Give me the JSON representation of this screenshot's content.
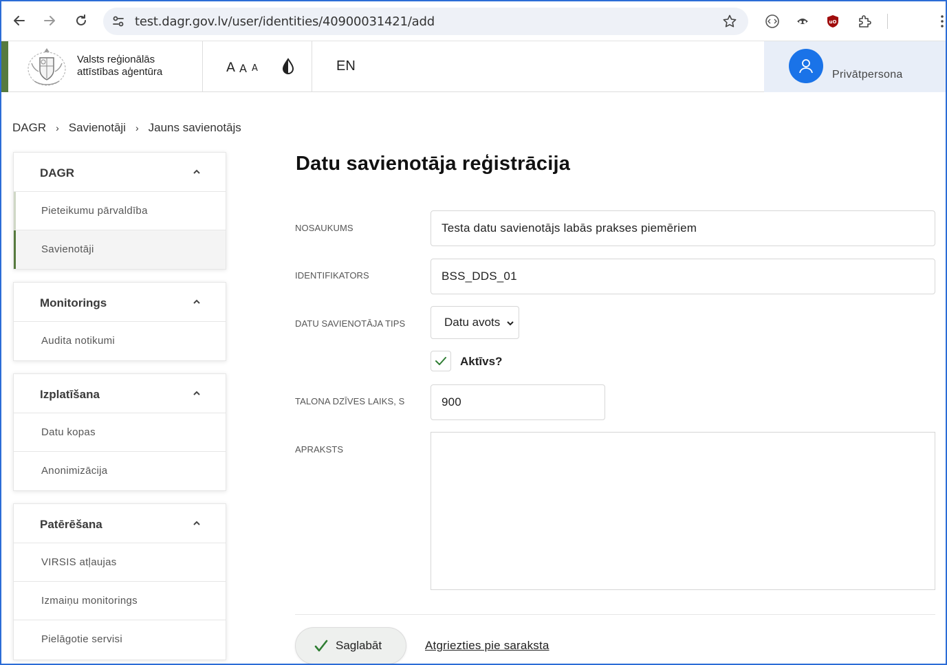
{
  "browser": {
    "url": "test.dagr.gov.lv/user/identities/40900031421/add"
  },
  "header": {
    "org_line1": "Valsts reģionālās",
    "org_line2": "attīstības aģentūra",
    "size_small": "A",
    "size_medium": "A",
    "size_large": "A",
    "language": "EN",
    "user_label": "Privātpersona"
  },
  "breadcrumb": {
    "items": [
      "DAGR",
      "Savienotāji",
      "Jauns savienotājs"
    ],
    "separator": "›"
  },
  "sidebar": {
    "groups": [
      {
        "title": "DAGR",
        "items": [
          "Pieteikumu pārvaldība",
          "Savienotāji"
        ]
      },
      {
        "title": "Monitorings",
        "items": [
          "Audita notikumi"
        ]
      },
      {
        "title": "Izplatīšana",
        "items": [
          "Datu kopas",
          "Anonimizācija"
        ]
      },
      {
        "title": "Patērēšana",
        "items": [
          "VIRSIS atļaujas",
          "Izmaiņu monitorings",
          "Pielāgotie servisi"
        ]
      }
    ]
  },
  "form": {
    "title": "Datu savienotāja reģistrācija",
    "name_label": "NOSAUKUMS",
    "name_value": "Testa datu savienotājs labās prakses piemēriem",
    "id_label": "IDENTIFIKATORS",
    "id_value": "BSS_DDS_01",
    "type_label": "DATU SAVIENOTĀJA TIPS",
    "type_value": "Datu avots",
    "active_label": "Aktīvs?",
    "active_checked": true,
    "ttl_label": "TALONA DZĪVES LAIKS, S",
    "ttl_value": "900",
    "description_label": "APRAKSTS",
    "description_value": "",
    "save_label": "Saglabāt",
    "back_label": "Atgriezties pie saraksta"
  },
  "colors": {
    "accent_green": "#567a3e",
    "primary_blue": "#1a73e8",
    "user_area_bg": "#e8eef8"
  }
}
